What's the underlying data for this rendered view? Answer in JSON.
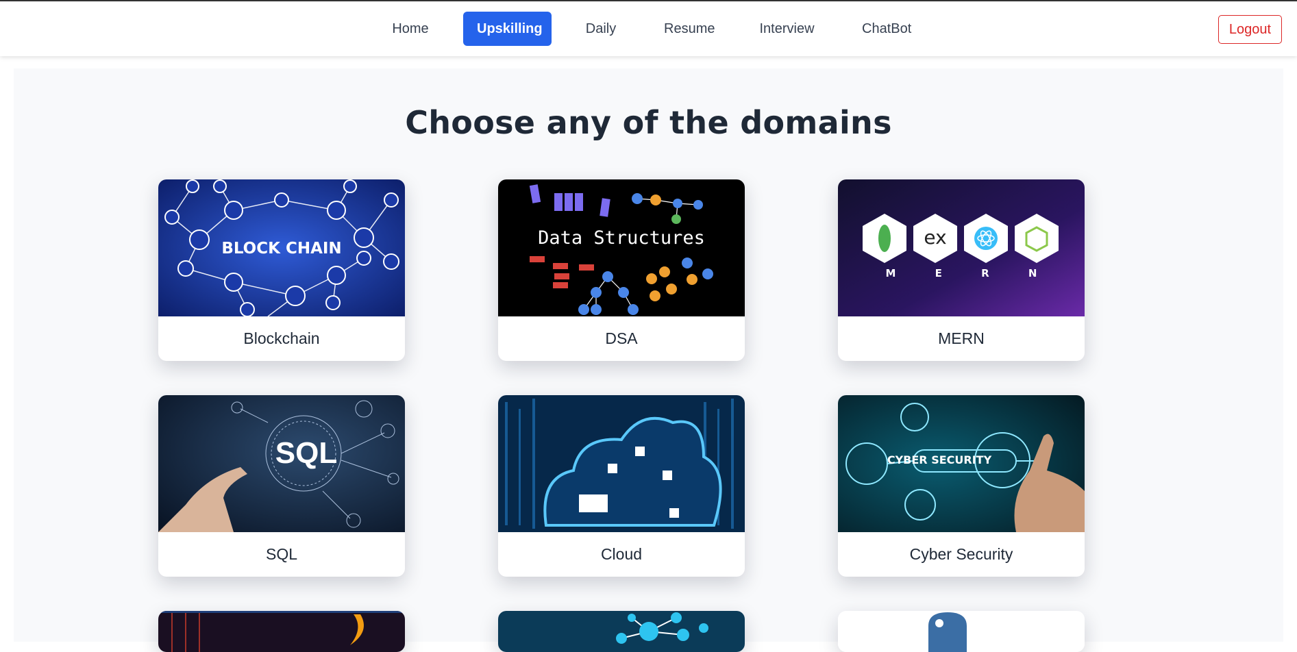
{
  "nav": {
    "links": [
      "Home",
      "Upskilling",
      "Daily",
      "Resume",
      "Interview",
      "ChatBot"
    ],
    "active": "Upskilling",
    "logout_label": "Logout"
  },
  "main": {
    "heading": "Choose any of the domains",
    "cards": [
      {
        "label": "Blockchain",
        "image_text": "BLOCK CHAIN"
      },
      {
        "label": "DSA",
        "image_text": "Data Structures"
      },
      {
        "label": "MERN",
        "image_text": "M E R N"
      },
      {
        "label": "SQL",
        "image_text": "SQL"
      },
      {
        "label": "Cloud",
        "image_text": ""
      },
      {
        "label": "Cyber Security",
        "image_text": "CYBER SECURITY"
      }
    ]
  },
  "colors": {
    "accent": "#2563eb",
    "logout": "#dc2626",
    "background": "#f8f9fb"
  }
}
